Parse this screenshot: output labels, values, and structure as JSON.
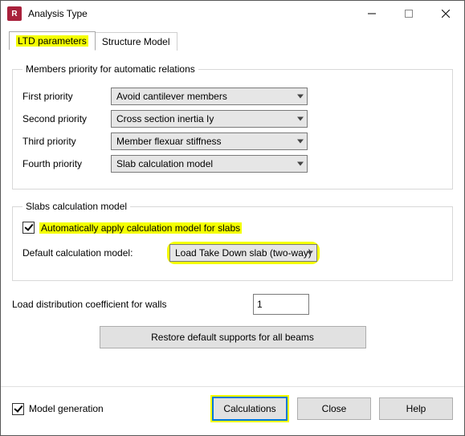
{
  "window": {
    "title": "Analysis Type"
  },
  "tabs": {
    "active": "LTD parameters",
    "inactive": "Structure Model"
  },
  "priority_group": {
    "legend": "Members priority for automatic relations",
    "rows": [
      {
        "label": "First priority",
        "value": "Avoid cantilever members"
      },
      {
        "label": "Second priority",
        "value": "Cross section inertia Iy"
      },
      {
        "label": "Third priority",
        "value": "Member flexuar stiffness"
      },
      {
        "label": "Fourth priority",
        "value": "Slab calculation model"
      }
    ]
  },
  "slabs_group": {
    "legend": "Slabs calculation model",
    "auto_apply_label": "Automatically apply calculation model for slabs",
    "auto_apply_checked": true,
    "default_label": "Default calculation model:",
    "default_value": "Load Take Down slab (two-way)"
  },
  "load_coeff": {
    "label": "Load distribution coefficient for walls",
    "value": "1"
  },
  "restore_button": "Restore default supports for all beams",
  "model_gen": {
    "label": "Model generation",
    "checked": true
  },
  "buttons": {
    "calc": "Calculations",
    "close": "Close",
    "help": "Help"
  }
}
